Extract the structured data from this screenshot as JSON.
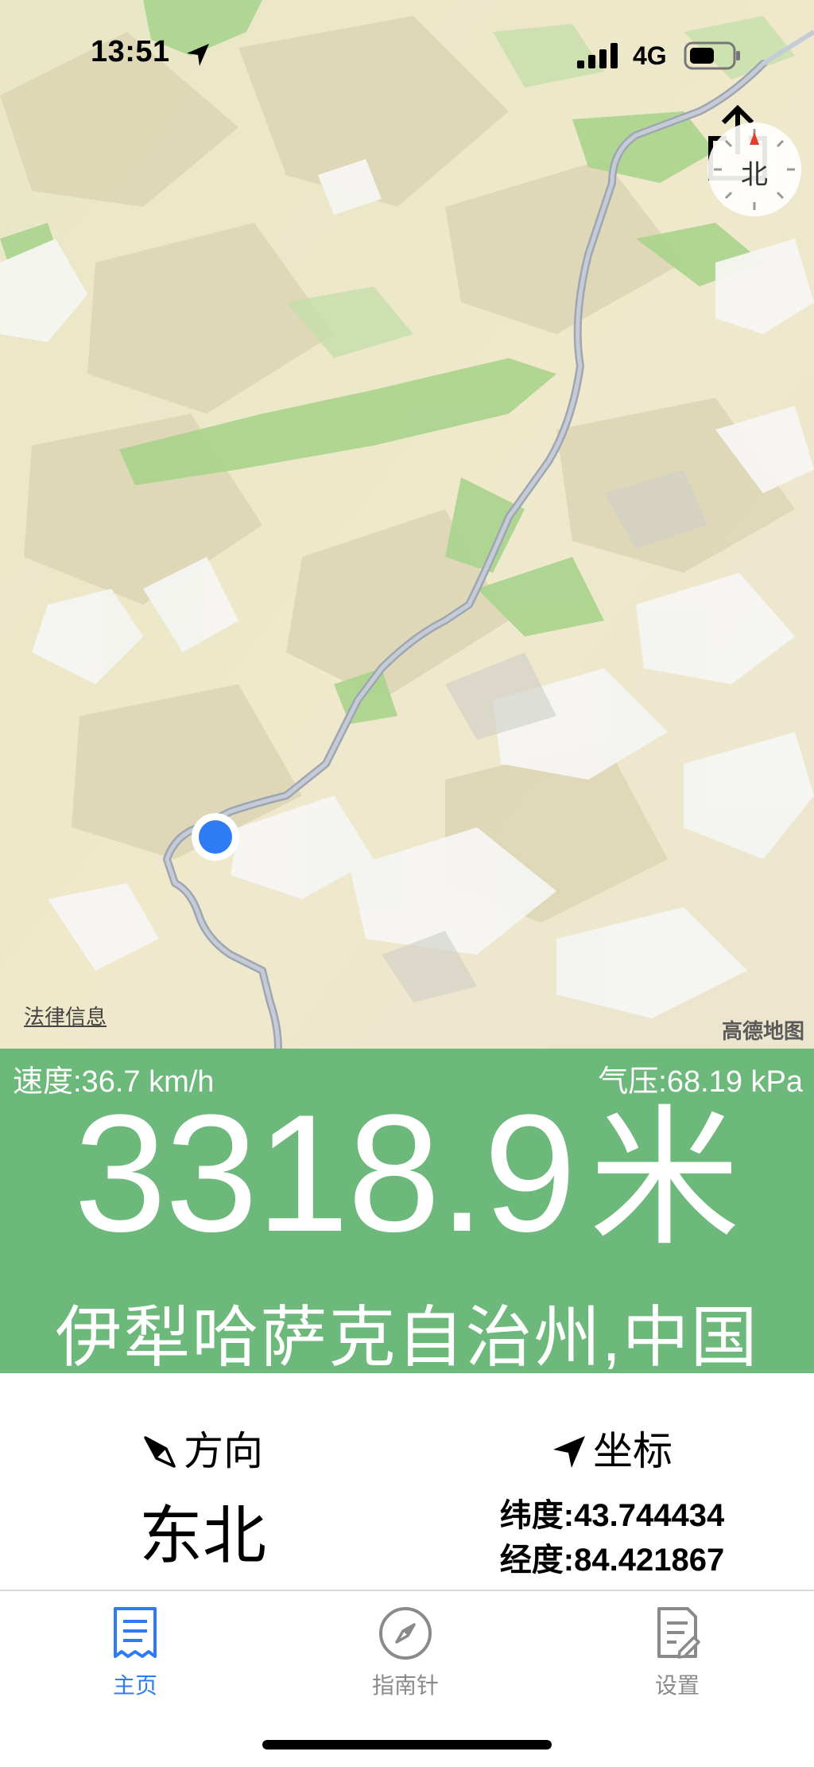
{
  "status_bar": {
    "time": "13:51",
    "network": "4G",
    "icons": [
      "location-arrow-icon",
      "signal-icon",
      "battery-icon"
    ]
  },
  "map": {
    "compass_label": "北",
    "legal_link": "法律信息",
    "brand": "高德地图",
    "share_icon": "share-icon",
    "colors": {
      "route": "#a9b0bd",
      "marker": "#2f7bf6",
      "forest": "#9fcf86",
      "snow": "#f3f4f6"
    }
  },
  "panel": {
    "speed": "速度:36.7 km/h",
    "pressure": "气压:68.19 kPa",
    "altitude": "3318.9",
    "altitude_unit": "米",
    "location": "伊犁哈萨克自治州,中国",
    "color": "#6db87b"
  },
  "info": {
    "direction_label": "方向",
    "direction_value": "东北",
    "coord_label": "坐标",
    "latitude": "纬度:43.744434",
    "longitude": "经度:84.421867"
  },
  "tabbar": {
    "tabs": [
      {
        "label": "主页",
        "icon": "receipt-icon",
        "active": true
      },
      {
        "label": "指南针",
        "icon": "compass-icon",
        "active": false
      },
      {
        "label": "设置",
        "icon": "settings-doc-icon",
        "active": false
      }
    ],
    "active_color": "#2f7bf6"
  }
}
